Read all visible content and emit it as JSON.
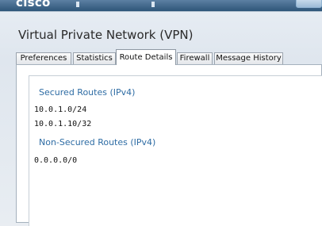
{
  "app": {
    "brand": "cisco"
  },
  "window": {
    "title": "Virtual Private Network (VPN)"
  },
  "tabs": [
    {
      "label": "Preferences",
      "active": false
    },
    {
      "label": "Statistics",
      "active": false
    },
    {
      "label": "Route Details",
      "active": true
    },
    {
      "label": "Firewall",
      "active": false
    },
    {
      "label": "Message History",
      "active": false
    }
  ],
  "route_details": {
    "secured": {
      "title": "Secured Routes (IPv4)",
      "routes": [
        "10.0.1.0/24",
        "10.0.1.10/32"
      ]
    },
    "non_secured": {
      "title": "Non-Secured Routes (IPv4)",
      "routes": [
        "0.0.0.0/0"
      ]
    }
  },
  "colors": {
    "accent": "#2e6ca4",
    "banner": "#2e5579"
  }
}
